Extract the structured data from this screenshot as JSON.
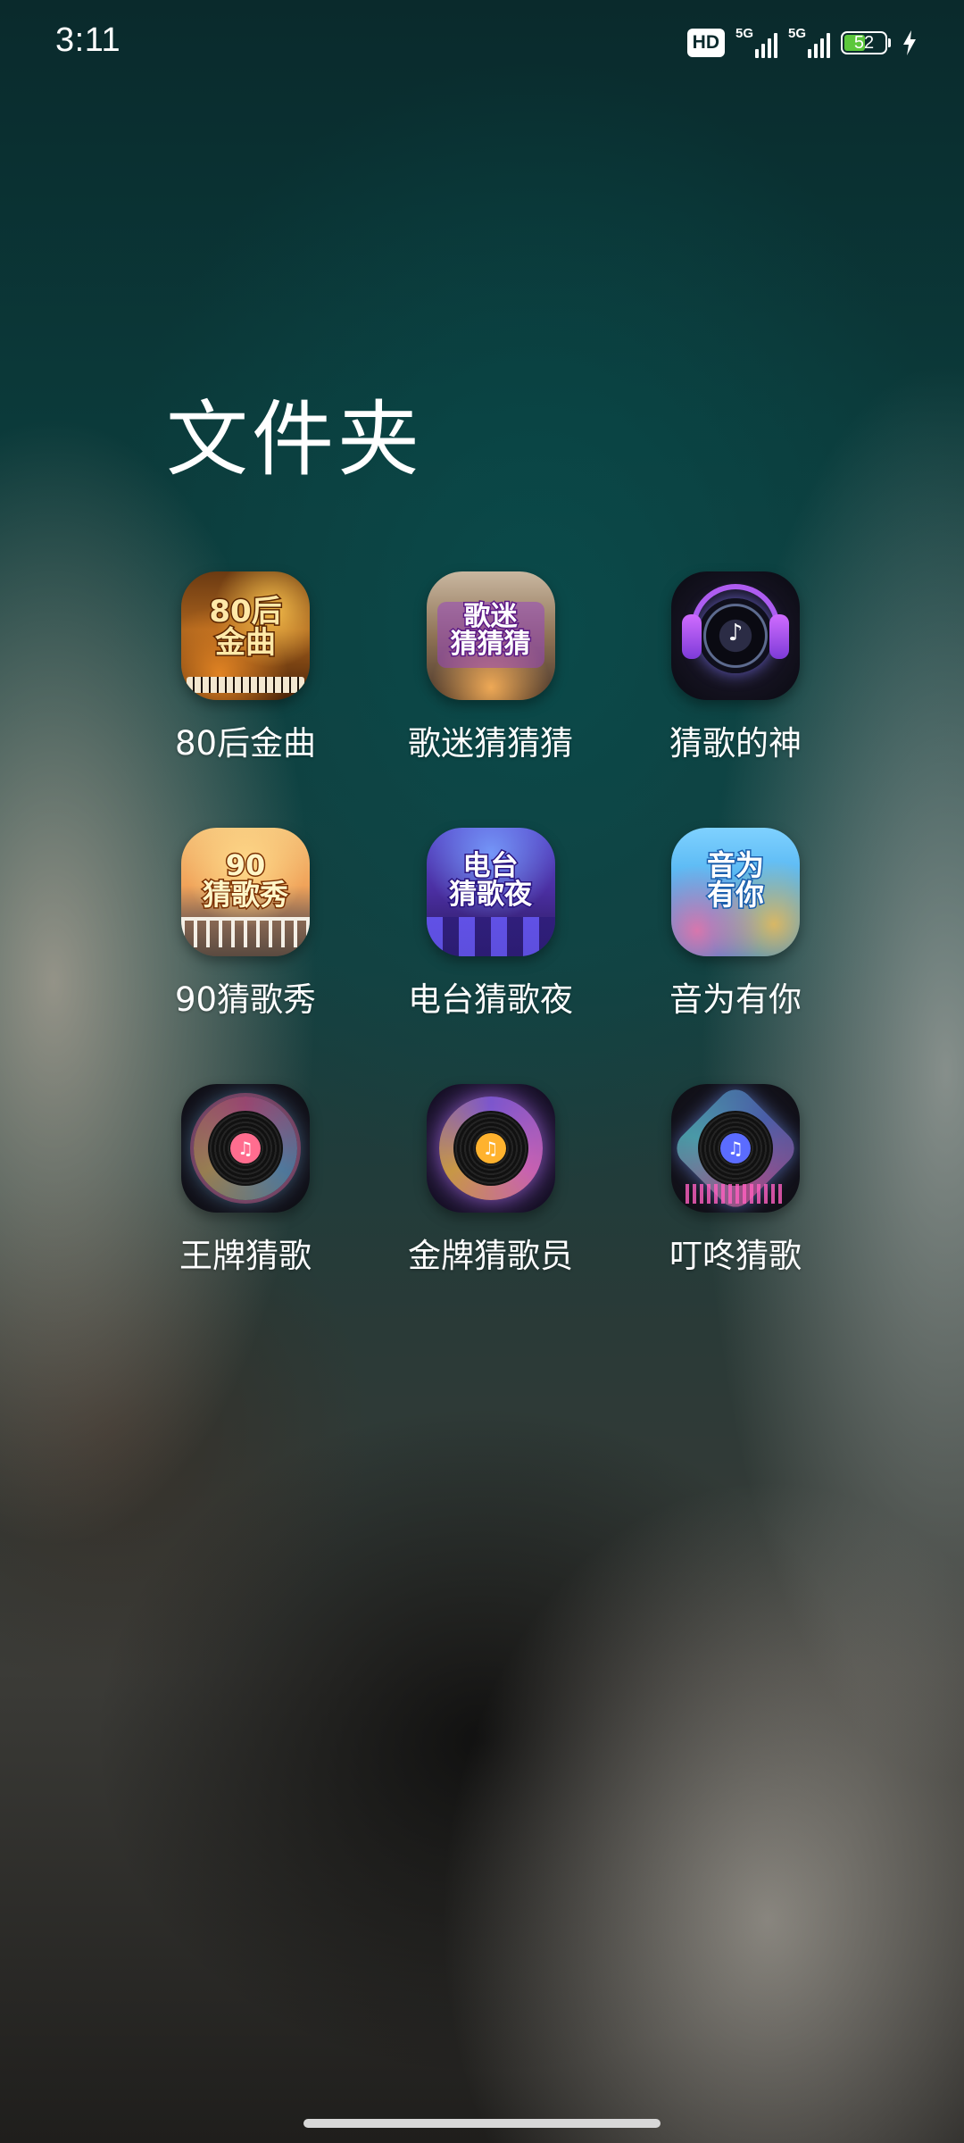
{
  "status_bar": {
    "time": "3:11",
    "hd_badge": "HD",
    "signal_1_label": "5G",
    "signal_2_label": "5G",
    "battery_level": "52",
    "charging": true
  },
  "folder": {
    "title": "文件夹",
    "apps": [
      {
        "label": "80后金曲",
        "icon_text": "80后\n金曲"
      },
      {
        "label": "歌迷猜猜猜",
        "icon_text": "歌迷\n猜猜猜"
      },
      {
        "label": "猜歌的神",
        "icon_text": ""
      },
      {
        "label": "90猜歌秀",
        "icon_text": "90\n猜歌秀"
      },
      {
        "label": "电台猜歌夜",
        "icon_text": "电台\n猜歌夜"
      },
      {
        "label": "音为有你",
        "icon_text": "音为\n有你"
      },
      {
        "label": "王牌猜歌",
        "icon_text": ""
      },
      {
        "label": "金牌猜歌员",
        "icon_text": ""
      },
      {
        "label": "叮咚猜歌",
        "icon_text": ""
      }
    ]
  },
  "colors": {
    "battery_fill": "#5cc73c",
    "text": "#ffffff"
  }
}
